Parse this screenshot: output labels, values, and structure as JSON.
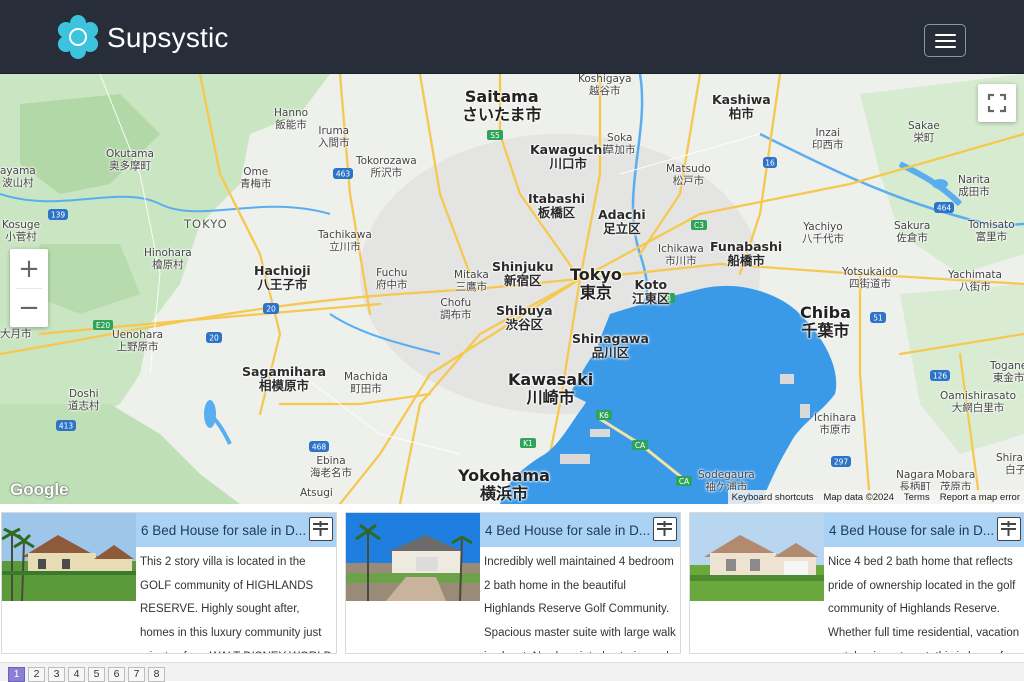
{
  "header": {
    "brand": "Supsystic",
    "logo_icon": "gear-flower-icon",
    "menu_icon": "hamburger-menu-icon",
    "colors": {
      "bar": "#272e39",
      "logo": "#3cc3dd"
    }
  },
  "map": {
    "labels": [
      {
        "t": "Saitama\nさいたま市",
        "c": "big"
      },
      {
        "t": "Koshigaya\n越谷市",
        "c": "sm"
      },
      {
        "t": "Kashiwa\n柏市",
        "c": "sm"
      },
      {
        "t": "Kawaguchi\n川口市",
        "c": "sm"
      },
      {
        "t": "Soka\n草加市",
        "c": "sm"
      },
      {
        "t": "Matsudo\n松戸市",
        "c": "sm"
      },
      {
        "t": "Inzai\n印西市",
        "c": "sm"
      },
      {
        "t": "Sakae\n栄町",
        "c": "sm"
      },
      {
        "t": "Narita\n成田市",
        "c": "sm"
      },
      {
        "t": "Hanno\n飯能市",
        "c": "sm"
      },
      {
        "t": "Iruma\n入間市",
        "c": "sm"
      },
      {
        "t": "Tokorozawa\n所沢市",
        "c": "sm"
      },
      {
        "t": "Okutama\n奥多摩町",
        "c": "sm"
      },
      {
        "t": "Ome\n青梅市",
        "c": "sm"
      },
      {
        "t": "ayama\n波山村",
        "c": "sm"
      },
      {
        "t": "Kosuge\n小菅村",
        "c": "sm"
      },
      {
        "t": "TOKYO",
        "c": "green"
      },
      {
        "t": "Itabashi\n板橋区",
        "c": "med"
      },
      {
        "t": "Adachi\n足立区",
        "c": "med"
      },
      {
        "t": "Yachiyo\n八千代市",
        "c": "sm"
      },
      {
        "t": "Sakura\n佐倉市",
        "c": "sm"
      },
      {
        "t": "Tomisato\n富里市",
        "c": "sm"
      },
      {
        "t": "Tachikawa\n立川市",
        "c": "sm"
      },
      {
        "t": "Hinohara\n檜原村",
        "c": "sm"
      },
      {
        "t": "Ichikawa\n市川市",
        "c": "sm"
      },
      {
        "t": "Funabashi\n船橋市",
        "c": "med"
      },
      {
        "t": "Hachioji\n八王子市",
        "c": "med"
      },
      {
        "t": "Fuchu\n府中市",
        "c": "sm"
      },
      {
        "t": "Mitaka\n三鷹市",
        "c": "sm"
      },
      {
        "t": "Shinjuku\n新宿区",
        "c": "med"
      },
      {
        "t": "Tokyo\n東京",
        "c": "big"
      },
      {
        "t": "Koto\n江東区",
        "c": "med"
      },
      {
        "t": "Yotsukaido\n四街道市",
        "c": "sm"
      },
      {
        "t": "Yachimata\n八街市",
        "c": "sm"
      },
      {
        "t": "Chofu\n調布市",
        "c": "sm"
      },
      {
        "t": "Shibuya\n渋谷区",
        "c": "med"
      },
      {
        "t": "Chiba\n千葉市",
        "c": "big"
      },
      {
        "t": "Uenohara\n上野原市",
        "c": "sm"
      },
      {
        "t": "大月市",
        "c": "sm"
      },
      {
        "t": "Shinagawa\n品川区",
        "c": "med"
      },
      {
        "t": "Sagamihara\n相模原市",
        "c": "med"
      },
      {
        "t": "Machida\n町田市",
        "c": "sm"
      },
      {
        "t": "Kawasaki\n川崎市",
        "c": "big"
      },
      {
        "t": "Togane\n東金市",
        "c": "sm"
      },
      {
        "t": "Doshi\n道志村",
        "c": "sm"
      },
      {
        "t": "Oamishirasato\n大網白里市",
        "c": "sm"
      },
      {
        "t": "Ichihara\n市原市",
        "c": "sm"
      },
      {
        "t": "Ebina\n海老名市",
        "c": "sm"
      },
      {
        "t": "Nagara\n長柄町",
        "c": "sm"
      },
      {
        "t": "Mobara\n茂原市",
        "c": "sm"
      },
      {
        "t": "Yokohama\n横浜市",
        "c": "big"
      },
      {
        "t": "Sodegaura\n袖ケ浦市",
        "c": "sm"
      },
      {
        "t": "Atsugi",
        "c": "sm"
      },
      {
        "t": "Shirako\n白子",
        "c": "sm"
      }
    ],
    "route_shields": [
      "S5",
      "16",
      "139",
      "463",
      "C3",
      "464",
      "20",
      "E20",
      "20",
      "B",
      "51",
      "126",
      "413",
      "468",
      "K6",
      "K1",
      "CA",
      "CA",
      "297",
      "16"
    ],
    "fullscreen_icon": "fullscreen-icon",
    "zoom_in": "+",
    "zoom_out": "−",
    "google": "Google",
    "attribution": [
      "Keyboard shortcuts",
      "Map data ©2024",
      "Terms",
      "Report a map error"
    ],
    "colors": {
      "water": "#3b9ae8",
      "land": "#eef0ec",
      "park": "#c9e5c2",
      "road": "#f6c850"
    }
  },
  "cards": [
    {
      "title": "6 Bed House for sale in D...",
      "description": "This 2 story villa is located in the GOLF community of HIGHLANDS RESERVE. Highly sought after, homes in this luxury community just minutes from WALT DISNEY WORLD",
      "filter_icon": "filter-sliders-icon"
    },
    {
      "title": "4 Bed House for sale in D...",
      "description": "Incredibly well maintained 4 bedroom 2 bath home in the beautiful Highlands Reserve Golf Community. Spacious master suite with large walk in closet. Newly painted exterior and",
      "filter_icon": "filter-sliders-icon"
    },
    {
      "title": "4 Bed House for sale in D...",
      "description": "Nice 4 bed 2 bath home that reflects pride of ownership located in the golf community of Highlands Reserve. Whether full time residential, vacation rental or investment, this is home for",
      "filter_icon": "filter-sliders-icon"
    }
  ],
  "pagination": {
    "pages": [
      "1",
      "2",
      "3",
      "4",
      "5",
      "6",
      "7",
      "8"
    ],
    "current": "1"
  }
}
